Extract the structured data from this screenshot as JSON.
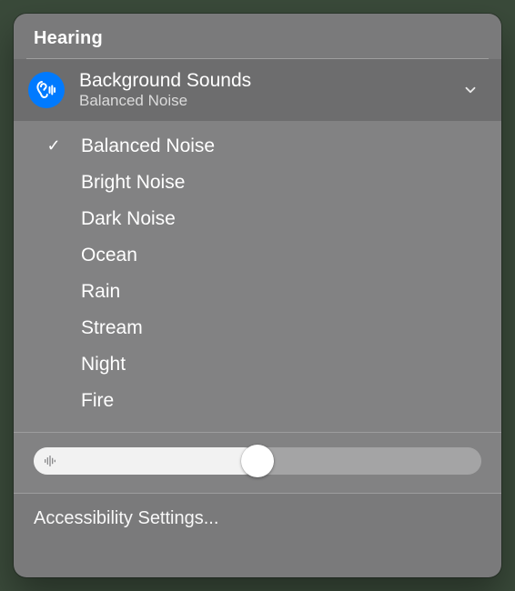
{
  "header": {
    "title": "Hearing"
  },
  "section": {
    "title": "Background Sounds",
    "subtitle": "Balanced Noise"
  },
  "options": [
    {
      "label": "Balanced Noise",
      "selected": true
    },
    {
      "label": "Bright Noise",
      "selected": false
    },
    {
      "label": "Dark Noise",
      "selected": false
    },
    {
      "label": "Ocean",
      "selected": false
    },
    {
      "label": "Rain",
      "selected": false
    },
    {
      "label": "Stream",
      "selected": false
    },
    {
      "label": "Night",
      "selected": false
    },
    {
      "label": "Fire",
      "selected": false
    }
  ],
  "slider": {
    "value_pct": 50
  },
  "footer": {
    "label": "Accessibility Settings..."
  },
  "glyphs": {
    "check": "✓"
  },
  "colors": {
    "accent": "#007aff"
  }
}
